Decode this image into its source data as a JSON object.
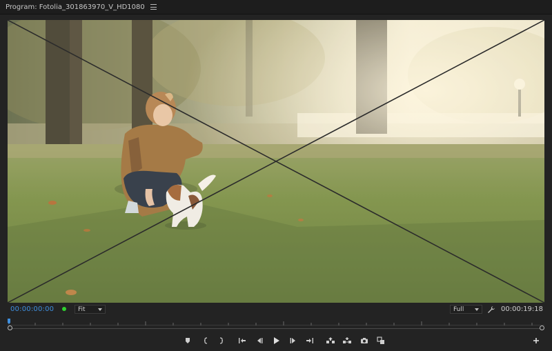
{
  "header": {
    "title": "Program: Fotolia_301863970_V_HD1080"
  },
  "controls": {
    "current_timecode": "00:00:00:00",
    "zoom_value": "Fit",
    "resolution_value": "Full",
    "duration_timecode": "00:00:19:18"
  },
  "colors": {
    "timecode_blue": "#3f8fde",
    "status_green": "#2fd12f",
    "panel_bg": "#232323"
  },
  "icons": {
    "panel_menu": "hamburger-menu-icon",
    "settings": "wrench-icon",
    "marker": "add-marker-icon",
    "mark_in": "mark-in-icon",
    "mark_out": "mark-out-icon",
    "go_to_in": "go-to-in-icon",
    "step_back": "step-back-icon",
    "play": "play-icon",
    "step_forward": "step-forward-icon",
    "go_to_out": "go-to-out-icon",
    "lift": "lift-icon",
    "extract": "extract-icon",
    "export_frame": "camera-icon",
    "comparison": "comparison-view-icon",
    "button_editor": "plus-icon"
  }
}
